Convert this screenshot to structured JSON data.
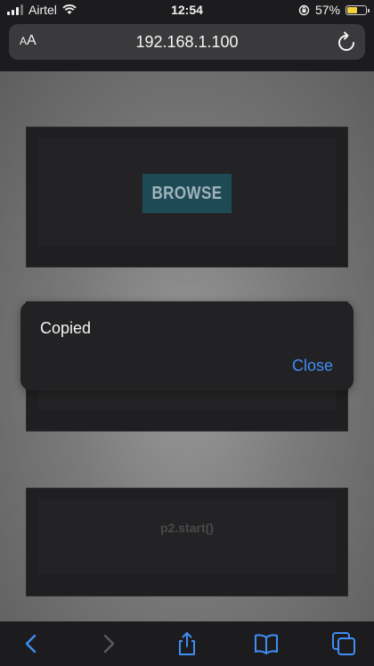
{
  "status_bar": {
    "carrier": "Airtel",
    "time": "12:54",
    "battery_percent_label": "57%",
    "battery_level": 0.57,
    "icons": [
      "signal-icon",
      "wifi-icon",
      "orientation-lock-icon",
      "battery-icon"
    ]
  },
  "address_bar": {
    "text_size_label": "AA",
    "url": "192.168.1.100",
    "reload_icon": "reload-icon"
  },
  "page": {
    "browse_label": "BROWSE",
    "code_text": "p2.start()"
  },
  "alert": {
    "message": "Copied",
    "close_label": "Close"
  },
  "toolbar": {
    "icons": [
      "back-icon",
      "forward-icon",
      "share-icon",
      "bookmarks-icon",
      "tabs-icon"
    ]
  },
  "colors": {
    "accent": "#3f8ef5",
    "browse_button": "#1e4a56",
    "battery": "#f2d23c"
  }
}
